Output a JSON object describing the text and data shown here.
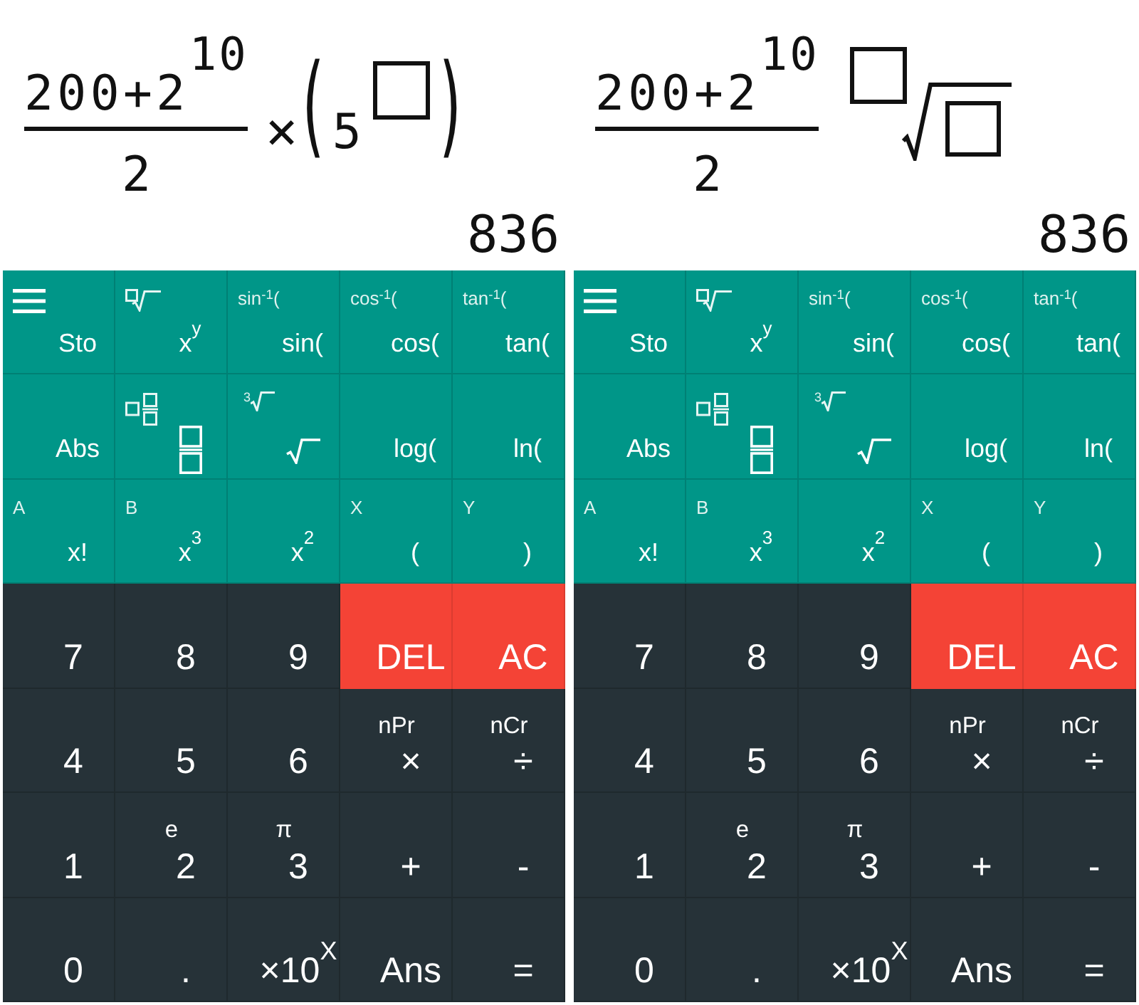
{
  "panels": [
    {
      "display": {
        "expression": {
          "fraction": {
            "numerator": "200+2",
            "numerator_exponent": "10",
            "denominator": "2"
          },
          "terms": [
            {
              "kind": "operator",
              "text": "×"
            },
            {
              "kind": "paren",
              "text": "("
            },
            {
              "kind": "number",
              "text": "5"
            },
            {
              "kind": "exponent-slot"
            },
            {
              "kind": "paren",
              "text": ")"
            }
          ]
        },
        "result": "836"
      },
      "function_keys": [
        [
          {
            "alt": {
              "kind": "menu"
            },
            "main": {
              "kind": "text",
              "text": "Sto"
            }
          },
          {
            "alt": {
              "kind": "box-root"
            },
            "main": {
              "kind": "text",
              "text": "x$^{y}$"
            }
          },
          {
            "alt": {
              "kind": "text",
              "text": "sin$^{-1}$("
            },
            "main": {
              "kind": "text",
              "text": "sin("
            }
          },
          {
            "alt": {
              "kind": "text",
              "text": "cos$^{-1}$("
            },
            "main": {
              "kind": "text",
              "text": "cos("
            }
          },
          {
            "alt": {
              "kind": "text",
              "text": "tan$^{-1}$("
            },
            "main": {
              "kind": "text",
              "text": "tan("
            }
          }
        ],
        [
          {
            "main": {
              "kind": "text",
              "text": "Abs"
            }
          },
          {
            "alt": {
              "kind": "mixed-fraction"
            },
            "main": {
              "kind": "fraction"
            }
          },
          {
            "alt": {
              "kind": "root",
              "index": "3"
            },
            "main": {
              "kind": "root"
            }
          },
          {
            "main": {
              "kind": "text",
              "text": "log("
            }
          },
          {
            "main": {
              "kind": "text",
              "text": "ln("
            }
          }
        ],
        [
          {
            "alt": {
              "kind": "text",
              "text": "A"
            },
            "main": {
              "kind": "text",
              "text": "x!"
            }
          },
          {
            "alt": {
              "kind": "text",
              "text": "B"
            },
            "main": {
              "kind": "text",
              "text": "x$^{3}$"
            }
          },
          {
            "main": {
              "kind": "text",
              "text": "x$^{2}$"
            }
          },
          {
            "alt": {
              "kind": "text",
              "text": "X"
            },
            "main": {
              "kind": "text",
              "text": "("
            }
          },
          {
            "alt": {
              "kind": "text",
              "text": "Y"
            },
            "main": {
              "kind": "text",
              "text": ")"
            }
          }
        ]
      ],
      "number_keys": [
        [
          {
            "kind": "normal",
            "label": "7"
          },
          {
            "kind": "normal",
            "label": "8"
          },
          {
            "kind": "normal",
            "label": "9"
          },
          {
            "kind": "clear",
            "label": "DEL"
          },
          {
            "kind": "clear",
            "label": "AC"
          }
        ],
        [
          {
            "kind": "normal",
            "label": "4"
          },
          {
            "kind": "normal",
            "label": "5"
          },
          {
            "kind": "normal",
            "label": "6"
          },
          {
            "kind": "normal",
            "alt": "nPr",
            "label": "×"
          },
          {
            "kind": "normal",
            "alt": "nCr",
            "label": "÷"
          }
        ],
        [
          {
            "kind": "normal",
            "label": "1"
          },
          {
            "kind": "normal",
            "alt": "e",
            "label": "2"
          },
          {
            "kind": "normal",
            "alt": "π",
            "label": "3"
          },
          {
            "kind": "normal",
            "label": "+"
          },
          {
            "kind": "normal",
            "label": "-"
          }
        ],
        [
          {
            "kind": "normal",
            "label": "0"
          },
          {
            "kind": "normal",
            "label": "."
          },
          {
            "kind": "normal",
            "label": "×10$^{X}$"
          },
          {
            "kind": "normal",
            "label": "Ans"
          },
          {
            "kind": "normal",
            "label": "="
          }
        ]
      ]
    },
    {
      "display": {
        "expression": {
          "fraction": {
            "numerator": "200+2",
            "numerator_exponent": "10",
            "denominator": "2"
          },
          "terms": [
            {
              "kind": "root-slot"
            }
          ]
        },
        "result": "836"
      },
      "function_keys": [
        [
          {
            "alt": {
              "kind": "menu"
            },
            "main": {
              "kind": "text",
              "text": "Sto"
            }
          },
          {
            "alt": {
              "kind": "box-root"
            },
            "main": {
              "kind": "text",
              "text": "x$^{y}$"
            }
          },
          {
            "alt": {
              "kind": "text",
              "text": "sin$^{-1}$("
            },
            "main": {
              "kind": "text",
              "text": "sin("
            }
          },
          {
            "alt": {
              "kind": "text",
              "text": "cos$^{-1}$("
            },
            "main": {
              "kind": "text",
              "text": "cos("
            }
          },
          {
            "alt": {
              "kind": "text",
              "text": "tan$^{-1}$("
            },
            "main": {
              "kind": "text",
              "text": "tan("
            }
          }
        ],
        [
          {
            "main": {
              "kind": "text",
              "text": "Abs"
            }
          },
          {
            "alt": {
              "kind": "mixed-fraction"
            },
            "main": {
              "kind": "fraction"
            }
          },
          {
            "alt": {
              "kind": "root",
              "index": "3"
            },
            "main": {
              "kind": "root"
            }
          },
          {
            "main": {
              "kind": "text",
              "text": "log("
            }
          },
          {
            "main": {
              "kind": "text",
              "text": "ln("
            }
          }
        ],
        [
          {
            "alt": {
              "kind": "text",
              "text": "A"
            },
            "main": {
              "kind": "text",
              "text": "x!"
            }
          },
          {
            "alt": {
              "kind": "text",
              "text": "B"
            },
            "main": {
              "kind": "text",
              "text": "x$^{3}$"
            }
          },
          {
            "main": {
              "kind": "text",
              "text": "x$^{2}$"
            }
          },
          {
            "alt": {
              "kind": "text",
              "text": "X"
            },
            "main": {
              "kind": "text",
              "text": "("
            }
          },
          {
            "alt": {
              "kind": "text",
              "text": "Y"
            },
            "main": {
              "kind": "text",
              "text": ")"
            }
          }
        ]
      ],
      "number_keys": [
        [
          {
            "kind": "normal",
            "label": "7"
          },
          {
            "kind": "normal",
            "label": "8"
          },
          {
            "kind": "normal",
            "label": "9"
          },
          {
            "kind": "clear",
            "label": "DEL"
          },
          {
            "kind": "clear",
            "label": "AC"
          }
        ],
        [
          {
            "kind": "normal",
            "label": "4"
          },
          {
            "kind": "normal",
            "label": "5"
          },
          {
            "kind": "normal",
            "label": "6"
          },
          {
            "kind": "normal",
            "alt": "nPr",
            "label": "×"
          },
          {
            "kind": "normal",
            "alt": "nCr",
            "label": "÷"
          }
        ],
        [
          {
            "kind": "normal",
            "label": "1"
          },
          {
            "kind": "normal",
            "alt": "e",
            "label": "2"
          },
          {
            "kind": "normal",
            "alt": "π",
            "label": "3"
          },
          {
            "kind": "normal",
            "label": "+"
          },
          {
            "kind": "normal",
            "label": "-"
          }
        ],
        [
          {
            "kind": "normal",
            "label": "0"
          },
          {
            "kind": "normal",
            "label": "."
          },
          {
            "kind": "normal",
            "label": "×10$^{X}$"
          },
          {
            "kind": "normal",
            "label": "Ans"
          },
          {
            "kind": "normal",
            "label": "="
          }
        ]
      ]
    }
  ]
}
